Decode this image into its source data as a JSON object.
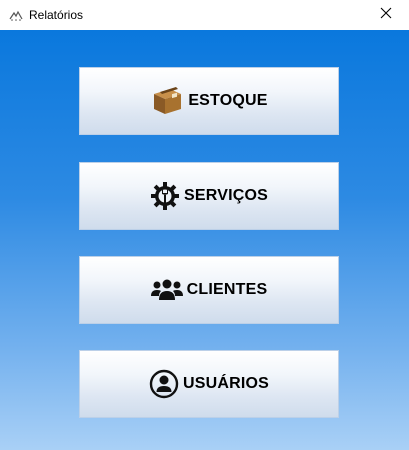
{
  "window": {
    "title": "Relatórios",
    "close_icon": "close-icon",
    "app_icon": "app-logo-icon"
  },
  "menu": [
    {
      "label": "ESTOQUE",
      "icon": "box-icon"
    },
    {
      "label": "SERVIÇOS",
      "icon": "wrench-gear-icon"
    },
    {
      "label": "CLIENTES",
      "icon": "users-icon"
    },
    {
      "label": "USUÁRIOS",
      "icon": "user-circle-icon"
    }
  ],
  "colors": {
    "background_top": "#0a78dd",
    "background_bottom": "#a9d0f6",
    "button_top": "#ffffff",
    "button_bottom": "#cfdcec"
  }
}
